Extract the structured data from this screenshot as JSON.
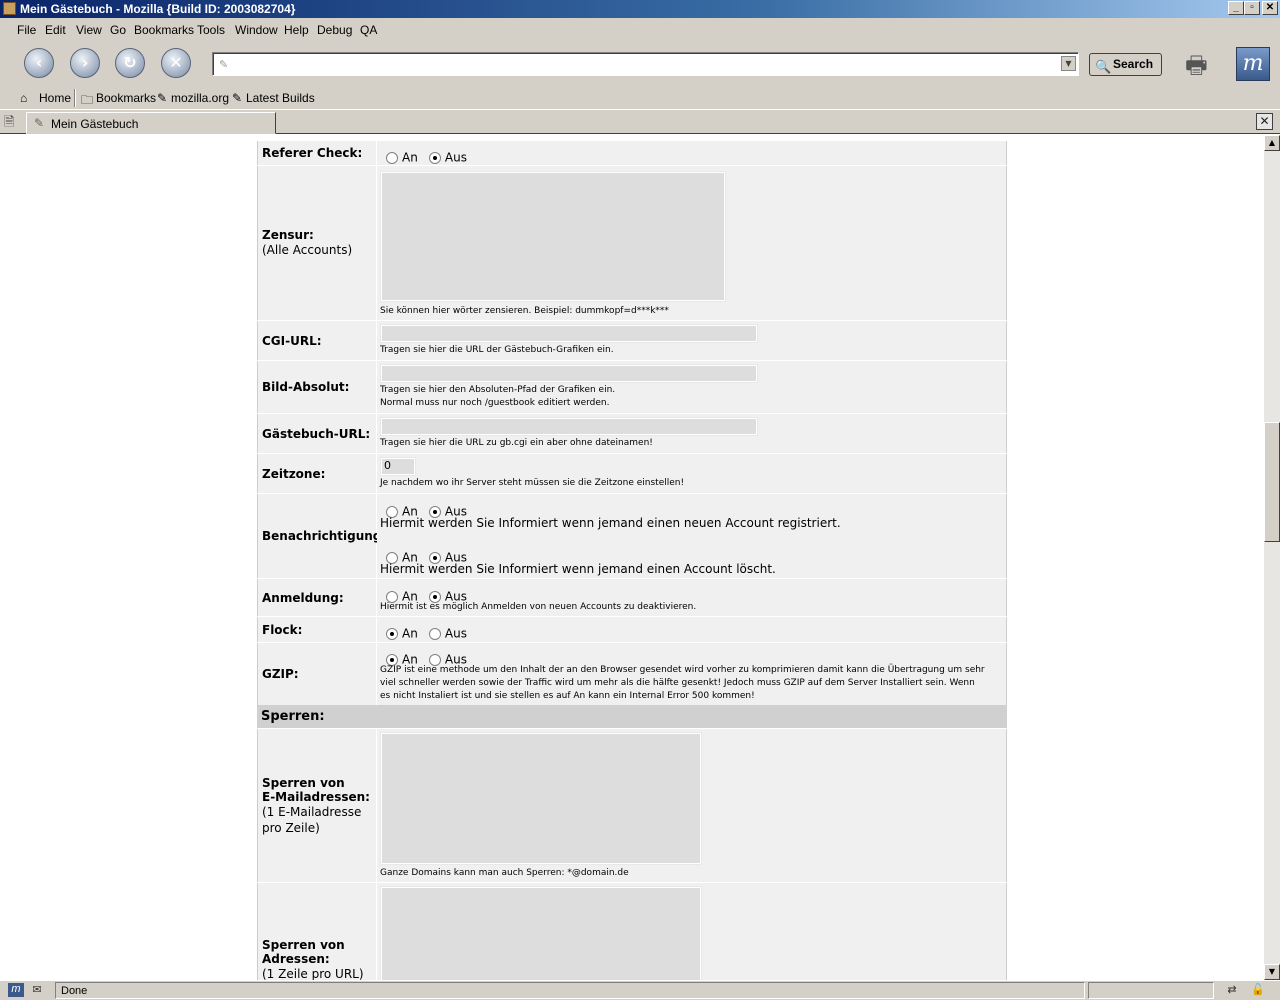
{
  "window": {
    "title": "Mein Gästebuch - Mozilla {Build ID: 2003082704}",
    "minimize": "_",
    "maximize": "▫",
    "close": "✕"
  },
  "menu": [
    "File",
    "Edit",
    "View",
    "Go",
    "Bookmarks",
    "Tools",
    "Window",
    "Help",
    "Debug",
    "QA"
  ],
  "nav": {
    "url_value": "",
    "search_label": "Search"
  },
  "bookmarks": {
    "home": "Home",
    "bookmarks": "Bookmarks",
    "mozilla": "mozilla.org",
    "latest": "Latest Builds"
  },
  "tab": {
    "label": "Mein Gästebuch"
  },
  "form": {
    "referer": {
      "label": "Referer Check:",
      "opt_an": "An",
      "opt_aus": "Aus",
      "selected": "Aus"
    },
    "zensur": {
      "label": "Zensur:",
      "sublabel": "(Alle Accounts)",
      "hint": "Sie können hier wörter zensieren. Beispiel: dummkopf=d***k***"
    },
    "cgi": {
      "label": "CGI-URL:",
      "hint": "Tragen sie hier die URL der Gästebuch-Grafiken ein."
    },
    "bild": {
      "label": "Bild-Absolut:",
      "hint1": "Tragen sie hier den Absoluten-Pfad der Grafiken ein.",
      "hint2": "Normal muss nur noch /guestbook editiert werden."
    },
    "gburl": {
      "label": "Gästebuch-URL:",
      "hint": "Tragen sie hier die URL zu gb.cgi ein aber ohne dateinamen!"
    },
    "zeitzone": {
      "label": "Zeitzone:",
      "value": "0",
      "hint": "Je nachdem wo ihr Server steht müssen sie die Zeitzone einstellen!"
    },
    "benach": {
      "label": "Benachrichtigung",
      "opt_an": "An",
      "opt_aus": "Aus",
      "text1": "Hiermit werden Sie Informiert wenn jemand einen neuen Account registriert.",
      "text2": "Hiermit werden Sie Informiert wenn jemand einen Account löscht."
    },
    "anmeldung": {
      "label": "Anmeldung:",
      "opt_an": "An",
      "opt_aus": "Aus",
      "hint": "Hiermit ist es möglich Anmelden von neuen Accounts zu deaktivieren."
    },
    "flock": {
      "label": "Flock:",
      "opt_an": "An",
      "opt_aus": "Aus"
    },
    "gzip": {
      "label": "GZIP:",
      "opt_an": "An",
      "opt_aus": "Aus",
      "hint1": "GZIP ist eine methode um den Inhalt der an den Browser gesendet wird vorher zu komprimieren damit kann die Übertragung um sehr",
      "hint2": "viel schneller werden sowie der Traffic wird um mehr als die hälfte gesenkt! Jedoch muss GZIP auf dem Server Installiert sein. Wenn",
      "hint3": "es nicht Instaliert ist und sie stellen es auf An kann ein Internal Error 500 kommen!"
    },
    "sperren_heading": "Sperren:",
    "sperr_mail": {
      "l1": "Sperren von",
      "l2": "E-Mailadressen:",
      "l3": "(1 E-Mailadresse",
      "l4": "pro Zeile)",
      "hint": "Ganze Domains kann man auch Sperren: *@domain.de"
    },
    "sperr_adr": {
      "l1": "Sperren von",
      "l2": "Adressen:",
      "l3": "(1 Zeile pro URL)"
    }
  },
  "status": {
    "text": "Done"
  }
}
